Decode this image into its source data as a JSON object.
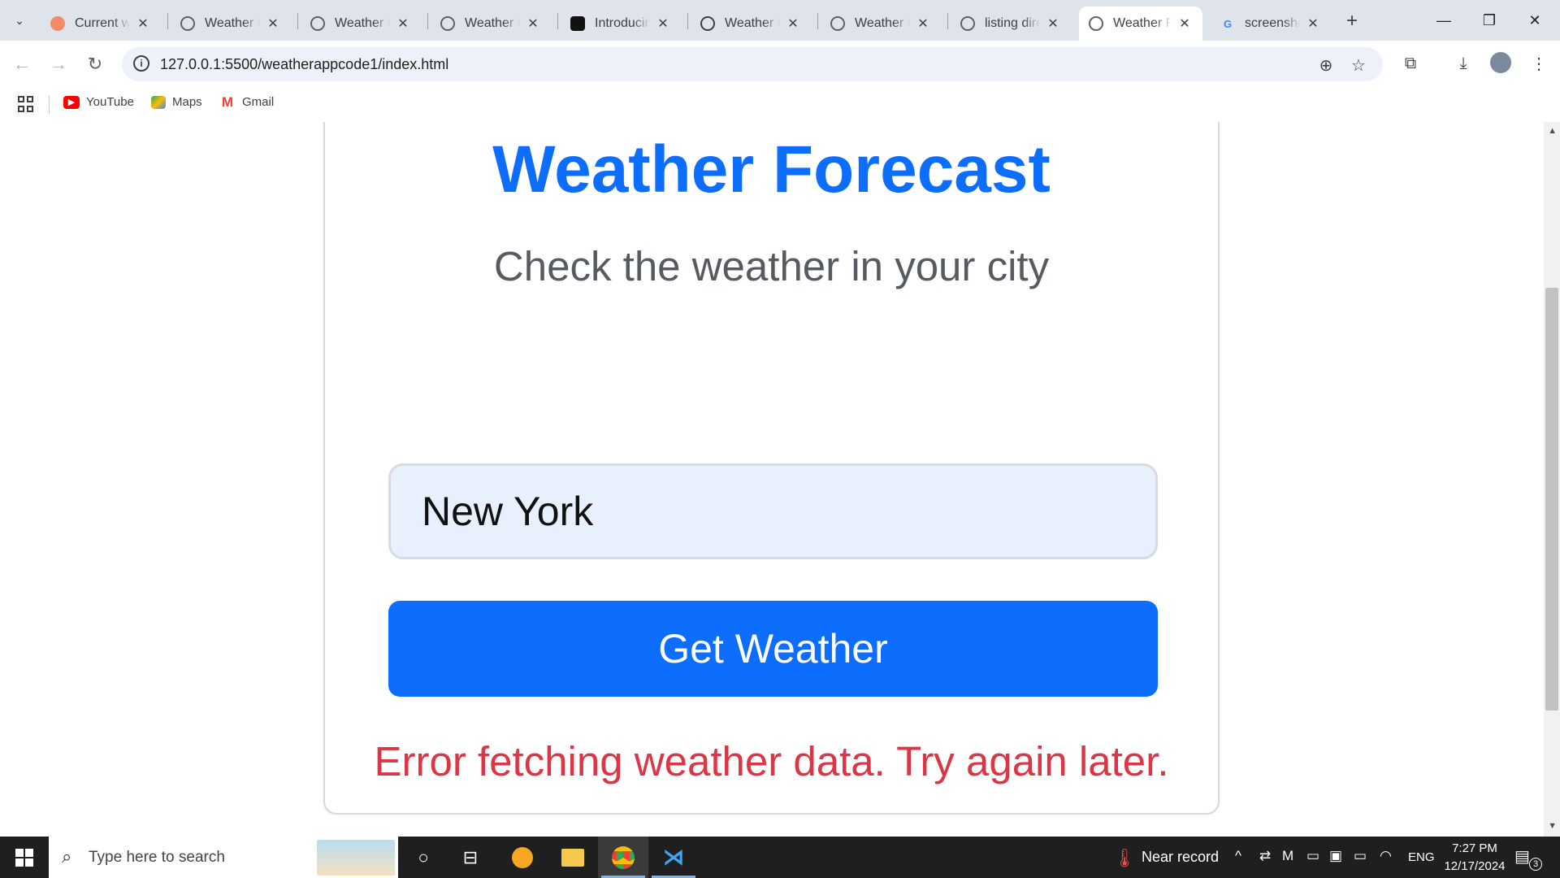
{
  "browser": {
    "tabs": [
      {
        "title": "Current we",
        "icon": "app-logo-icon"
      },
      {
        "title": "Weather Fo",
        "icon": "globe-icon"
      },
      {
        "title": "Weather Fo",
        "icon": "globe-icon"
      },
      {
        "title": "Weather Fo",
        "icon": "globe-icon"
      },
      {
        "title": "Introducing",
        "icon": "openai-icon"
      },
      {
        "title": "Weather Fo",
        "icon": "openai-icon"
      },
      {
        "title": "Weather Fo",
        "icon": "globe-icon"
      },
      {
        "title": "listing dire",
        "icon": "globe-icon"
      },
      {
        "title": "Weather Fo",
        "icon": "globe-icon"
      },
      {
        "title": "screenshot",
        "icon": "google-icon"
      }
    ],
    "active_tab_index": 8,
    "url": "127.0.0.1:5500/weatherappcode1/index.html",
    "bookmarks": [
      {
        "label": "YouTube",
        "icon": "youtube-icon",
        "color": "#ff0000"
      },
      {
        "label": "Maps",
        "icon": "maps-icon",
        "color": "#34a853"
      },
      {
        "label": "Gmail",
        "icon": "gmail-icon",
        "color": "#ea4335"
      }
    ]
  },
  "page": {
    "title": "Weather Forecast",
    "subtitle": "Check the weather in your city",
    "city_value": "New York",
    "button_label": "Get Weather",
    "error_message": "Error fetching weather data. Try again later.",
    "colors": {
      "primary": "#0d6efd",
      "error": "#dc3545",
      "subtitle": "#555b61"
    }
  },
  "taskbar": {
    "search_placeholder": "Type here to search",
    "weather_text": "Near record",
    "language": "ENG",
    "time": "7:27 PM",
    "date": "12/17/2024",
    "notification_count": "3"
  }
}
